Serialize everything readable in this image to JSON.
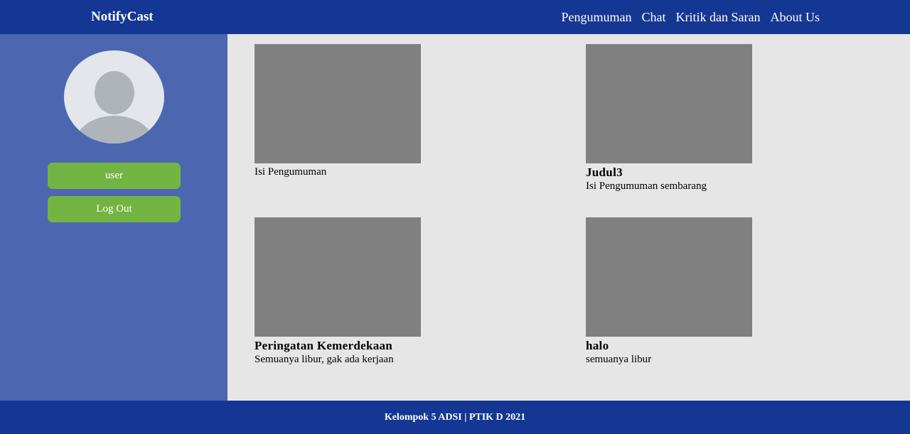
{
  "header": {
    "brand": "NotifyCast",
    "nav": [
      "Pengumuman",
      "Chat",
      "Kritik dan Saran",
      "About Us"
    ]
  },
  "sidebar": {
    "user_label": "user",
    "logout_label": "Log Out"
  },
  "announcements": [
    {
      "title": "",
      "body": "Isi Pengumuman"
    },
    {
      "title": "Judul3",
      "body": "Isi Pengumuman sembarang"
    },
    {
      "title": "Peringatan Kemerdekaan",
      "body": "Semuanya libur, gak ada kerjaan"
    },
    {
      "title": "halo",
      "body": "semuanya libur"
    }
  ],
  "footer": {
    "text": "Kelompok 5 ADSI | PTIK D 2021"
  },
  "colors": {
    "header_bg": "#153794",
    "sidebar_bg": "#4c67b0",
    "button_bg": "#73b443",
    "content_bg": "#e6e6e6",
    "image_placeholder": "#808080"
  }
}
